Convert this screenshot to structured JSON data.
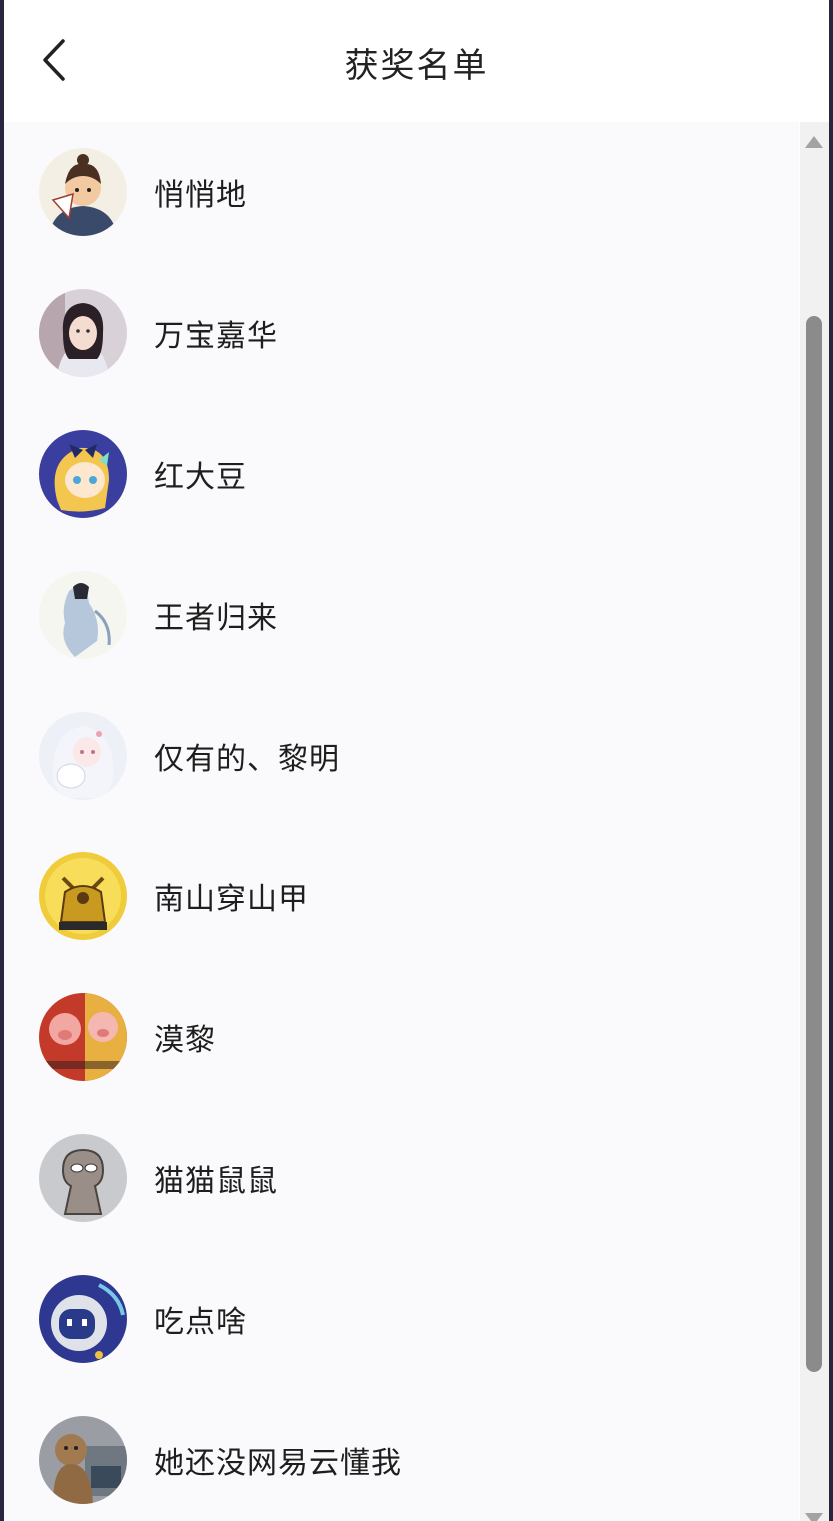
{
  "header": {
    "title": "获奖名单",
    "back_icon": "chevron-left-icon"
  },
  "winners": [
    {
      "name": "悄悄地",
      "avatar": "cartoon-girl-with-fan"
    },
    {
      "name": "万宝嘉华",
      "avatar": "photo-girl"
    },
    {
      "name": "红大豆",
      "avatar": "anime-blonde-girl"
    },
    {
      "name": "王者归来",
      "avatar": "painting-figure-in-blue"
    },
    {
      "name": "仅有的、黎明",
      "avatar": "anime-white-hair-girl"
    },
    {
      "name": "南山穿山甲",
      "avatar": "golden-armor-warrior"
    },
    {
      "name": "漠黎",
      "avatar": "cartoon-pigs"
    },
    {
      "name": "猫猫鼠鼠",
      "avatar": "sketch-cat"
    },
    {
      "name": "吃点啥",
      "avatar": "blue-robot"
    },
    {
      "name": "她还没网易云懂我",
      "avatar": "teddy-bear-with-laptop"
    }
  ],
  "colors": {
    "title": "#222222",
    "name": "#1e1e1e",
    "list_bg": "#fafafc",
    "scroll_thumb": "#8b8b8b"
  }
}
